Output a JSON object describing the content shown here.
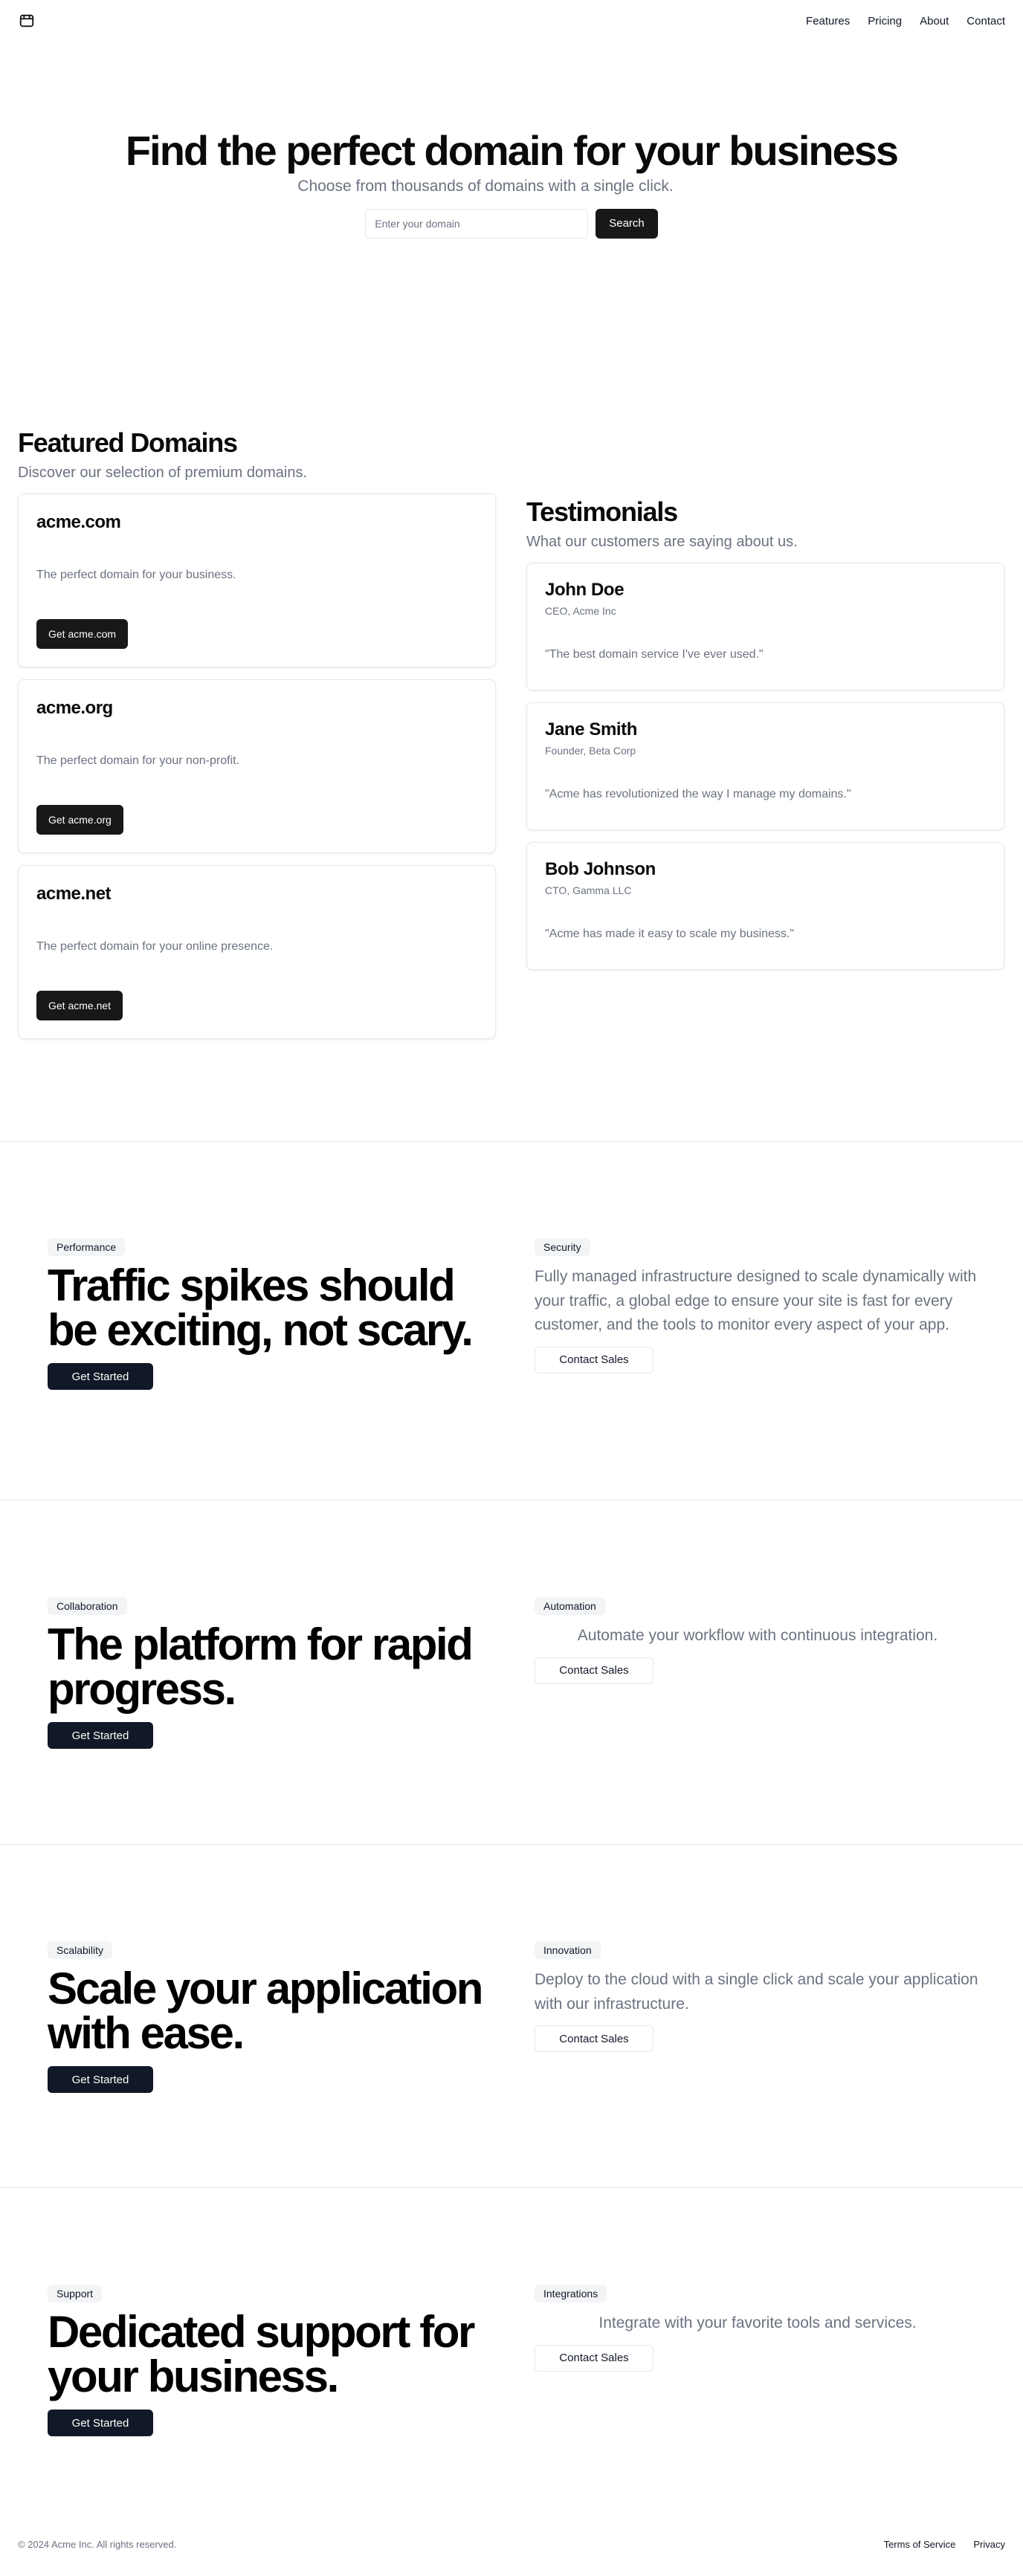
{
  "nav": {
    "logo_icon": "package-icon",
    "items": [
      {
        "label": "Features"
      },
      {
        "label": "Pricing"
      },
      {
        "label": "About"
      },
      {
        "label": "Contact"
      }
    ]
  },
  "hero": {
    "title": "Find the perfect domain for your business",
    "subtitle": "Choose from thousands of domains with a single click.",
    "search_placeholder": "Enter your domain",
    "search_value": "",
    "search_button": "Search"
  },
  "featured": {
    "title": "Featured Domains",
    "subtitle": "Discover our selection of premium domains.",
    "domains": [
      {
        "name": "acme.com",
        "description": "The perfect domain for your business.",
        "button": "Get acme.com"
      },
      {
        "name": "acme.org",
        "description": "The perfect domain for your non-profit.",
        "button": "Get acme.org"
      },
      {
        "name": "acme.net",
        "description": "The perfect domain for your online presence.",
        "button": "Get acme.net"
      }
    ]
  },
  "testimonials": {
    "title": "Testimonials",
    "subtitle": "What our customers are saying about us.",
    "items": [
      {
        "name": "John Doe",
        "role": "CEO, Acme Inc",
        "quote": "\"The best domain service I've ever used.\""
      },
      {
        "name": "Jane Smith",
        "role": "Founder, Beta Corp",
        "quote": "\"Acme has revolutionized the way I manage my domains.\""
      },
      {
        "name": "Bob Johnson",
        "role": "CTO, Gamma LLC",
        "quote": "\"Acme has made it easy to scale my business.\""
      }
    ]
  },
  "sections": [
    {
      "left_badge": "Performance",
      "title": "Traffic spikes should be exciting, not scary.",
      "primary_button": "Get Started",
      "right_badge": "Security",
      "description": "Fully managed infrastructure designed to scale dynamically with your traffic, a global edge to ensure your site is fast for every customer, and the tools to monitor every aspect of your app.",
      "secondary_button": "Contact Sales"
    },
    {
      "left_badge": "Collaboration",
      "title": "The platform for rapid progress.",
      "primary_button": "Get Started",
      "right_badge": "Automation",
      "description": "Automate your workflow with continuous integration.",
      "secondary_button": "Contact Sales"
    },
    {
      "left_badge": "Scalability",
      "title": "Scale your application with ease.",
      "primary_button": "Get Started",
      "right_badge": "Innovation",
      "description": "Deploy to the cloud with a single click and scale your application with our infrastructure.",
      "secondary_button": "Contact Sales"
    },
    {
      "left_badge": "Support",
      "title": "Dedicated support for your business.",
      "primary_button": "Get Started",
      "right_badge": "Integrations",
      "description": "Integrate with your favorite tools and services.",
      "secondary_button": "Contact Sales"
    }
  ],
  "footer": {
    "copyright": "© 2024 Acme Inc. All rights reserved.",
    "links": [
      {
        "label": "Terms of Service"
      },
      {
        "label": "Privacy"
      }
    ]
  }
}
